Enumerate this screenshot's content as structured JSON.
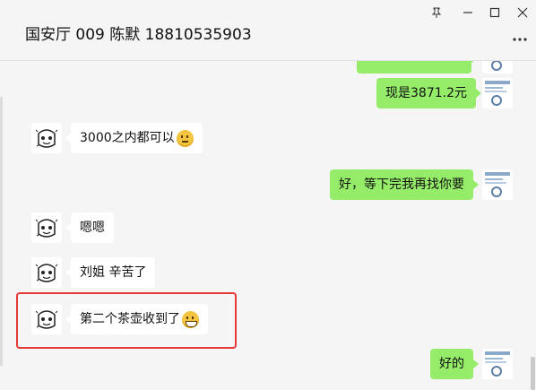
{
  "window": {
    "title": "国安厅 009  陈默 18810535903",
    "pin_icon": "pin-icon",
    "min_icon": "minimize-icon",
    "max_icon": "maximize-icon",
    "close_icon": "close-icon",
    "more_icon": "more-icon"
  },
  "messages": [
    {
      "side": "right",
      "text": "",
      "partial": true
    },
    {
      "side": "right",
      "text": "现是3871.2元"
    },
    {
      "side": "left",
      "text": "3000之内都可以",
      "emoji": "thinking-face"
    },
    {
      "side": "right",
      "text": "好，等下完我再找你要"
    },
    {
      "side": "left",
      "text": "嗯嗯"
    },
    {
      "side": "left",
      "text": "刘姐 辛苦了"
    },
    {
      "side": "left",
      "text": "第二个茶壶收到了",
      "emoji": "grinning-face",
      "highlighted": true
    },
    {
      "side": "right",
      "text": "好的"
    }
  ],
  "colors": {
    "background": "#f5f5f5",
    "sent_bubble": "#95ec69",
    "received_bubble": "#ffffff",
    "highlight": "#e53935"
  }
}
